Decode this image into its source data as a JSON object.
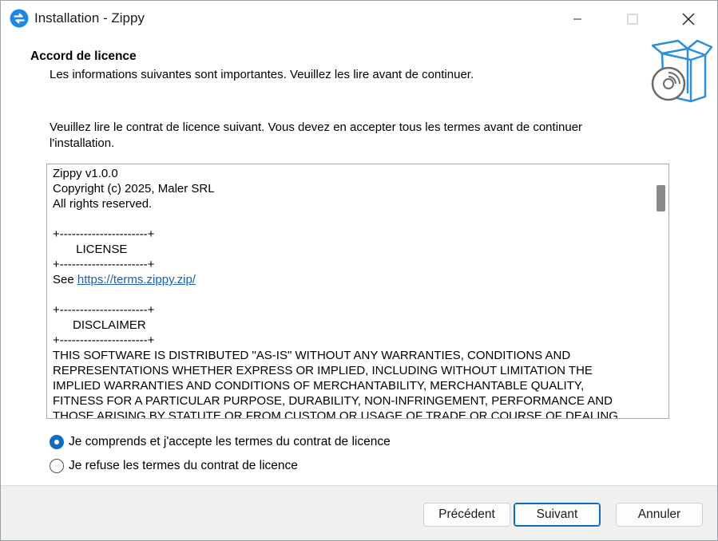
{
  "window": {
    "title": "Installation - Zippy",
    "icon": "zippy-app-icon",
    "controls": [
      "minimize-icon",
      "maximize-icon",
      "close-icon"
    ]
  },
  "header": {
    "title": "Accord de licence",
    "subtitle": "Les informations suivantes sont importantes. Veuillez les lire avant de continuer.",
    "icon": "install-box-disc-icon"
  },
  "intro": "Veuillez lire le contrat de licence suivant. Vous devez en accepter tous les termes avant de continuer l'installation.",
  "license": {
    "lines": [
      "Zippy v1.0.0",
      "Copyright (c) 2025, Maler SRL",
      "All rights reserved.",
      "",
      "+----------------------+",
      "       LICENSE",
      "+----------------------+"
    ],
    "see_prefix": "See ",
    "link_text": "https://terms.zippy.zip/",
    "lines_after_link": [
      "",
      "+----------------------+",
      "      DISCLAIMER",
      "+----------------------+",
      "THIS SOFTWARE IS DISTRIBUTED \"AS-IS\" WITHOUT ANY WARRANTIES, CONDITIONS AND",
      "REPRESENTATIONS WHETHER EXPRESS OR IMPLIED, INCLUDING WITHOUT LIMITATION THE",
      "IMPLIED WARRANTIES AND CONDITIONS OF MERCHANTABILITY, MERCHANTABLE QUALITY,",
      "FITNESS FOR A PARTICULAR PURPOSE, DURABILITY, NON-INFRINGEMENT, PERFORMANCE AND",
      "THOSE ARISING BY STATUTE OR FROM CUSTOM OR USAGE OF TRADE OR COURSE OF DEALING"
    ]
  },
  "options": {
    "accept_label": "Je comprends et j'accepte les termes du contrat de licence",
    "refuse_label": "Je refuse les termes du contrat de licence",
    "selected": "accept"
  },
  "buttons": {
    "previous": "Précédent",
    "next": "Suivant",
    "cancel": "Annuler"
  },
  "colors": {
    "accent": "#0f6cbd",
    "link": "#1a5fb4",
    "icon_blue": "#2e8ed8",
    "footer_bg": "#f0f0f0"
  }
}
